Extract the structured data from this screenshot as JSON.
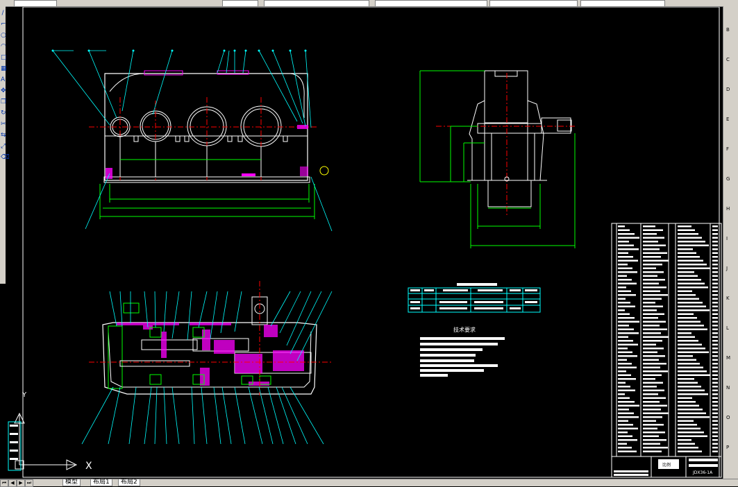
{
  "app": {
    "tabs": [
      "模型",
      "布局1",
      "布局2"
    ],
    "axis_label_x": "X",
    "axis_label_y": "Y"
  },
  "technical_requirements": {
    "heading": "技术要求"
  },
  "title_block": {
    "scale_label": "比例",
    "drawing_no": "JDX36-1A"
  },
  "right_ruler": [
    "B",
    "C",
    "D",
    "E",
    "F",
    "G",
    "H",
    "I",
    "J",
    "K",
    "L",
    "M",
    "N",
    "O",
    "P"
  ],
  "colors": {
    "background": "#000000",
    "outline": "#ffffff",
    "dimension": "#00ff00",
    "leader": "#00ffff",
    "center": "#ff0000",
    "highlight": "#ff00ff",
    "text": "#ffffff"
  },
  "icons": [
    "ucs-icon",
    "cursor-crosshair-icon"
  ]
}
